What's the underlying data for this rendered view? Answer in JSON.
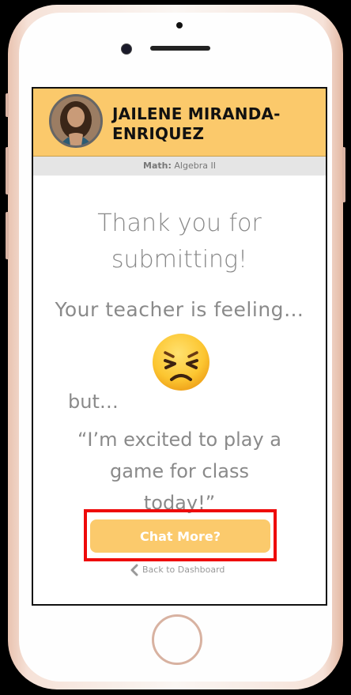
{
  "header": {
    "student_name": "JAILENE MIRANDA-ENRIQUEZ"
  },
  "subject": {
    "label": "Math:",
    "course": "Algebra II"
  },
  "main": {
    "thanks": "Thank you for submitting!",
    "feeling_prompt": "Your teacher is feeling…",
    "feeling_icon": "persevering-face-emoji",
    "but": "but…",
    "quote": "“I’m excited to play a game for class today!”"
  },
  "actions": {
    "chat_more": "Chat More?",
    "back": "Back to Dashboard"
  },
  "colors": {
    "accent": "#fbc96b",
    "highlight": "#ee0a0a"
  }
}
